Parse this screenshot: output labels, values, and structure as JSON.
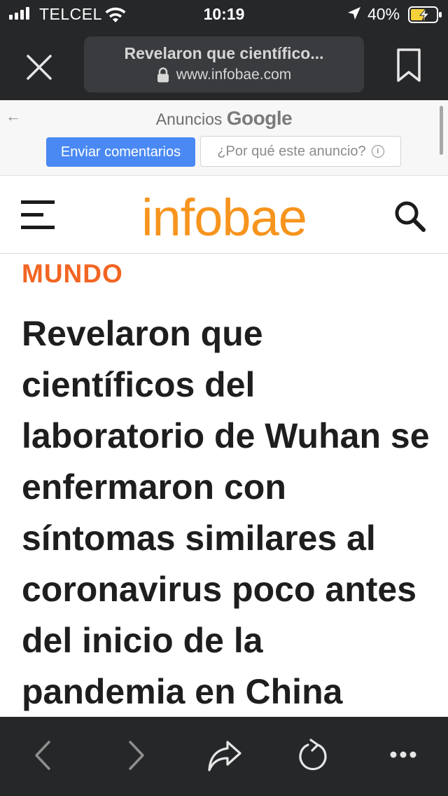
{
  "status_bar": {
    "carrier": "TELCEL",
    "time": "10:19",
    "battery": "40%"
  },
  "browser": {
    "page_title": "Revelaron que científico...",
    "domain": "www.infobae.com"
  },
  "ad": {
    "label": "Anuncios",
    "brand": "Google",
    "feedback_button": "Enviar comentarios",
    "why_button": "¿Por qué este anuncio?"
  },
  "site": {
    "logo": "infobae",
    "accent_color": "#f7941d"
  },
  "article": {
    "section": "MUNDO",
    "headline": "Revelaron que científicos del laboratorio de Wuhan se enfermaron con síntomas similares al coronavirus poco antes del inicio de la pandemia en China"
  },
  "icons": [
    "signal-icon",
    "wifi-icon",
    "location-arrow-icon",
    "battery-charging-icon",
    "close-icon",
    "lock-icon",
    "bookmark-icon",
    "back-arrow-icon",
    "info-icon",
    "hamburger-menu-icon",
    "search-icon",
    "chevron-left-icon",
    "chevron-right-icon",
    "share-icon",
    "reload-icon",
    "more-icon"
  ]
}
